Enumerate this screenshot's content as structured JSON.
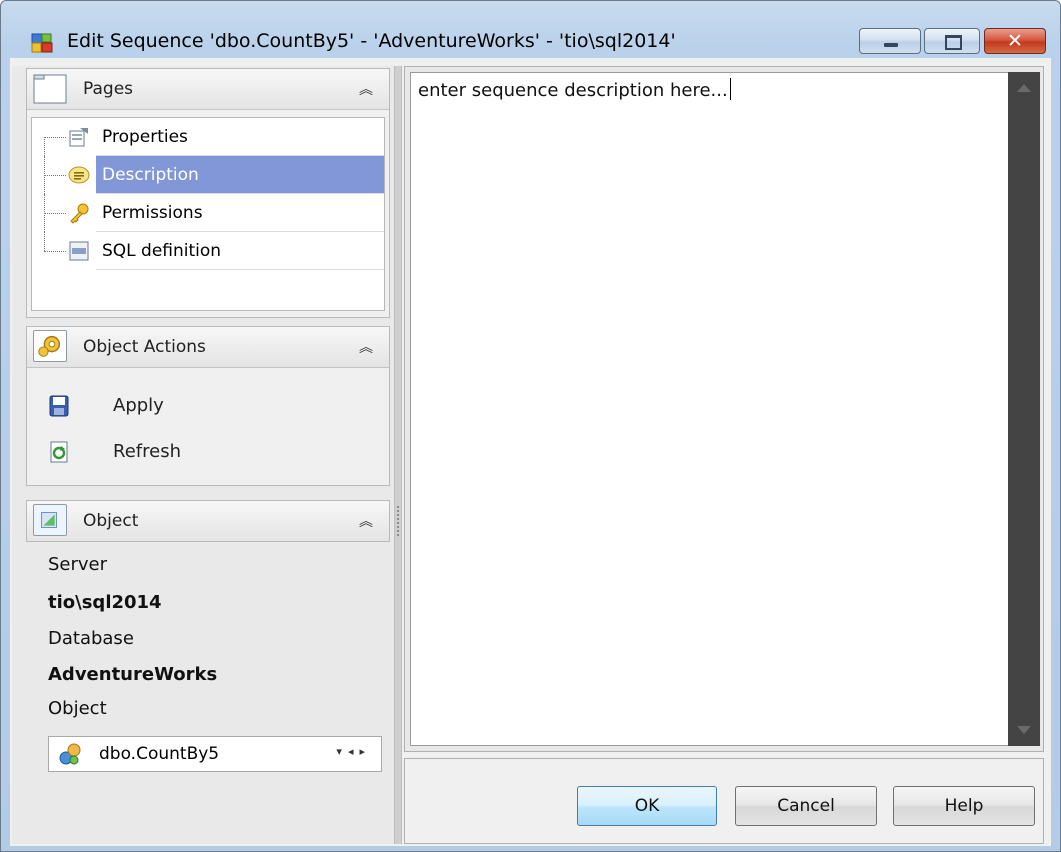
{
  "window": {
    "title": "Edit Sequence 'dbo.CountBy5' - 'AdventureWorks' - 'tio\\sql2014'",
    "close_glyph": "✕"
  },
  "pages_panel": {
    "title": "Pages",
    "collapse_glyph": "︽",
    "items": [
      {
        "label": "Properties",
        "icon": "properties-icon"
      },
      {
        "label": "Description",
        "icon": "description-icon",
        "selected": true
      },
      {
        "label": "Permissions",
        "icon": "key-icon"
      },
      {
        "label": "SQL definition",
        "icon": "sql-icon"
      }
    ]
  },
  "actions_panel": {
    "title": "Object Actions",
    "collapse_glyph": "︽",
    "items": [
      {
        "label": "Apply",
        "icon": "save-icon"
      },
      {
        "label": "Refresh",
        "icon": "refresh-icon"
      }
    ]
  },
  "object_panel": {
    "title": "Object",
    "collapse_glyph": "︽",
    "server_label": "Server",
    "server_value": "tio\\sql2014",
    "database_label": "Database",
    "database_value": "AdventureWorks",
    "object_label": "Object",
    "object_value": "dbo.CountBy5",
    "combo_arrows": "▾◂▸"
  },
  "editor": {
    "text": "enter sequence description here..."
  },
  "buttons": {
    "ok": "OK",
    "cancel": "Cancel",
    "help": "Help"
  },
  "colors": {
    "selection": "#8297d8",
    "titlebar": "#b9d1ea",
    "scrollbar": "#444444",
    "close_button": "#c23a1f"
  }
}
